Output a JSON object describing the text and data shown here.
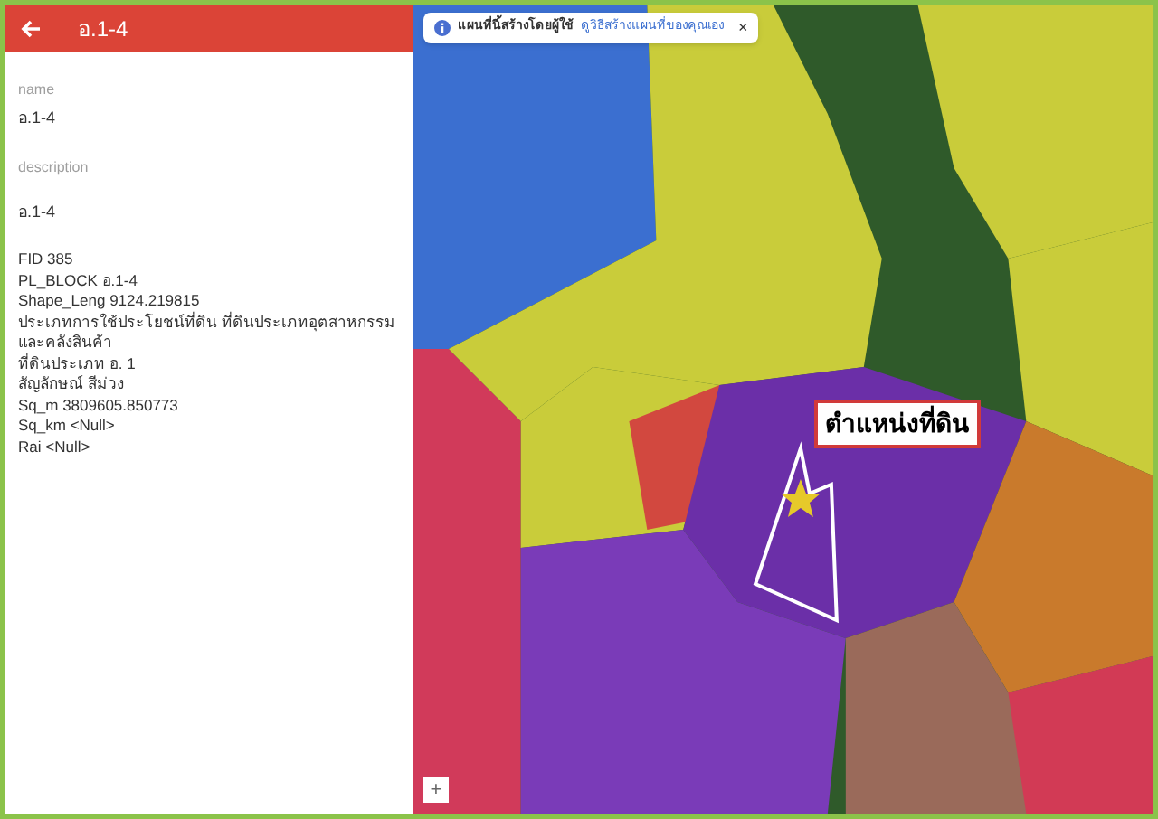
{
  "panel": {
    "title": "อ.1-4",
    "fields": [
      {
        "label": "name",
        "value": "อ.1-4"
      },
      {
        "label": "description",
        "value": "อ.1-4"
      }
    ],
    "attributes": [
      "FID 385",
      "PL_BLOCK อ.1-4",
      "Shape_Leng 9124.219815",
      "ประเภทการใช้ประโยชน์ที่ดิน ที่ดินประเภทอุตสาหกรรมและคลังสินค้า",
      "ที่ดินประเภท อ. 1",
      "สัญลักษณ์ สีม่วง",
      "Sq_m 3809605.850773",
      "Sq_km <Null>",
      "Rai <Null>"
    ]
  },
  "map": {
    "notice": {
      "title": "แผนที่นี้สร้างโดยผู้ใช้",
      "link": "ดูวิธีสร้างแผนที่ของคุณเอง",
      "close": "×"
    },
    "callout": "ตำแหน่งที่ดิน",
    "zoom_in": "+"
  }
}
